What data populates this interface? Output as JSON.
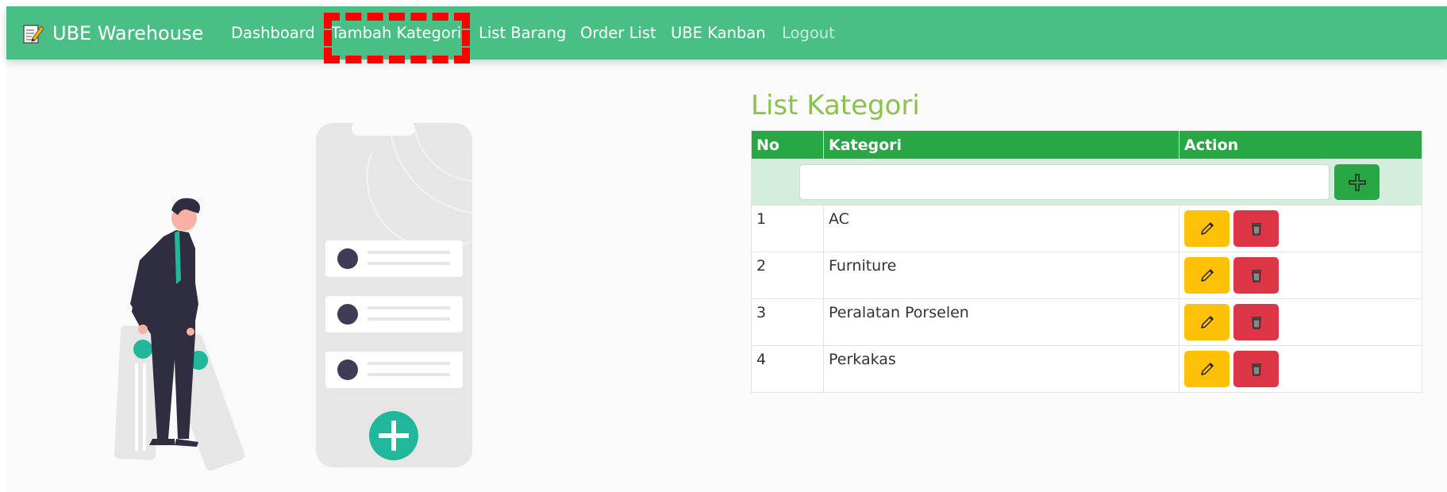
{
  "nav": {
    "brand": "UBE Warehouse",
    "items": [
      {
        "label": "Dashboard"
      },
      {
        "label": "Tambah Kategori"
      },
      {
        "label": "List Barang"
      },
      {
        "label": "Order List"
      },
      {
        "label": "UBE Kanban"
      },
      {
        "label": "Logout"
      }
    ]
  },
  "main": {
    "title": "List Kategori",
    "table": {
      "headers": [
        "No",
        "Kategori",
        "Action"
      ],
      "input_value": "",
      "rows": [
        {
          "no": "1",
          "kategori": "AC"
        },
        {
          "no": "2",
          "kategori": "Furniture"
        },
        {
          "no": "3",
          "kategori": "Peralatan Porselen"
        },
        {
          "no": "4",
          "kategori": "Perkakas"
        }
      ]
    }
  },
  "colors": {
    "navbar": "#49bf85",
    "title": "#8bc34a",
    "table_header": "#28a745",
    "edit_button": "#ffc107",
    "delete_button": "#dc3545",
    "highlight": "#ff0000"
  },
  "icons": {
    "brand": "notepad-pencil-icon",
    "add": "plus-icon",
    "edit": "pencil-icon",
    "delete": "trash-icon"
  }
}
